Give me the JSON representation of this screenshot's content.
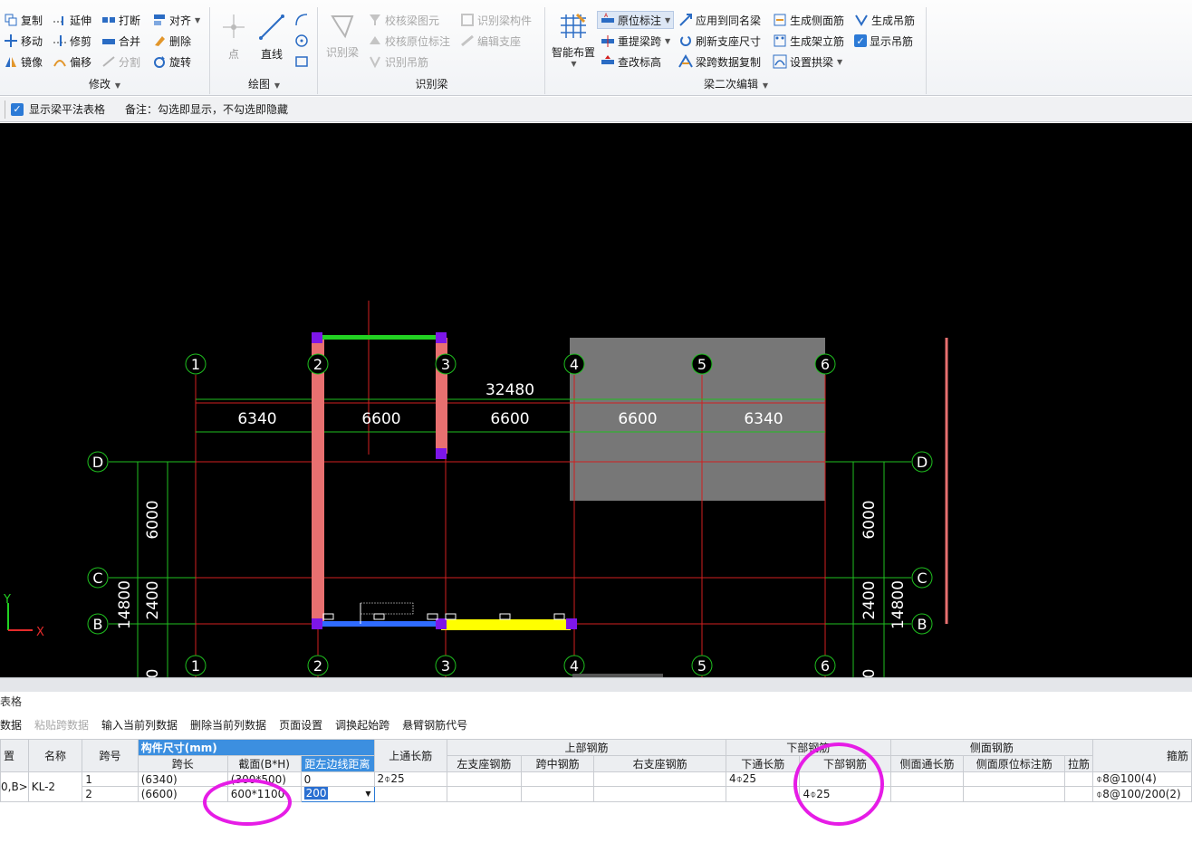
{
  "ribbon": {
    "modify": {
      "label": "修改",
      "buttons": [
        "复制",
        "延伸",
        "打断",
        "对齐",
        "移动",
        "修剪",
        "合并",
        "删除",
        "镜像",
        "偏移",
        "分割",
        "旋转"
      ]
    },
    "draw": {
      "label": "绘图",
      "point": "点",
      "line": "直线"
    },
    "identify": {
      "label": "识别梁",
      "identify_beam": "识别梁",
      "buttons": [
        "校核梁图元",
        "识别梁构件",
        "校核原位标注",
        "编辑支座",
        "识别吊筋"
      ]
    },
    "secondary": {
      "label": "梁二次编辑",
      "smart_layout": "智能布置",
      "buttons": [
        "原位标注",
        "应用到同名梁",
        "生成侧面筋",
        "生成吊筋",
        "重提梁跨",
        "刷新支座尺寸",
        "生成架立筋",
        "显示吊筋",
        "查改标高",
        "梁跨数据复制",
        "设置拱梁"
      ]
    }
  },
  "options": {
    "show_table_label": "显示梁平法表格",
    "note": "备注：勾选即显示，不勾选即隐藏"
  },
  "canvas": {
    "axis_numbers": [
      "1",
      "2",
      "3",
      "4",
      "5",
      "6"
    ],
    "axis_letters": [
      "D",
      "C",
      "B"
    ],
    "total_dim": "32480",
    "span_dims": [
      "6340",
      "6600",
      "6600",
      "6600",
      "6340"
    ],
    "row_dims": [
      "6000",
      "2400"
    ],
    "total_row_dim": "14800",
    "ucs_y": "Y",
    "ucs_x": "X",
    "colors": {
      "axis": "#d21f1f",
      "dim": "#1fbf1f",
      "beam_red": "#e87070",
      "beam_green": "#22d122",
      "beam_blue": "#2f6bff",
      "beam_yellow": "#ffff00",
      "grip": "#7d16e8",
      "grey_block": "#777777"
    }
  },
  "panel": {
    "title": "表格",
    "tools": [
      "数据",
      "粘贴跨数据",
      "输入当前列数据",
      "删除当前列数据",
      "页面设置",
      "调换起始跨",
      "悬臂钢筋代号"
    ],
    "headers": {
      "position": "置",
      "name": "名称",
      "span_no": "跨号",
      "size_group": "构件尺寸(mm)",
      "span_len": "跨长",
      "section": "截面(B*H)",
      "offset": "距左边线距离",
      "top_through": "上通长筋",
      "top_group": "上部钢筋",
      "left_support": "左支座钢筋",
      "mid_span": "跨中钢筋",
      "right_support": "右支座钢筋",
      "bottom_group": "下部钢筋",
      "bottom_through": "下通长筋",
      "bottom_bar": "下部钢筋",
      "side_group": "侧面钢筋",
      "side_through": "侧面通长筋",
      "side_in_situ": "侧面原位标注筋",
      "tie": "拉筋",
      "stirrup": "箍筋"
    },
    "rows": [
      {
        "position": "0,B>",
        "name": "KL-2",
        "span_no": "1",
        "span_len": "(6340)",
        "section": "(300*500)",
        "offset": "0",
        "top_through": "2⌽25",
        "bottom_through": "4⌽25",
        "bottom_bar": "",
        "stirrup": "⌽8@100(4)"
      },
      {
        "position": "",
        "name": "",
        "span_no": "2",
        "span_len": "(6600)",
        "section": "600*1100",
        "offset": "200",
        "top_through": "",
        "bottom_through": "",
        "bottom_bar": "4⌽25",
        "stirrup": "⌽8@100/200(2)"
      }
    ]
  }
}
